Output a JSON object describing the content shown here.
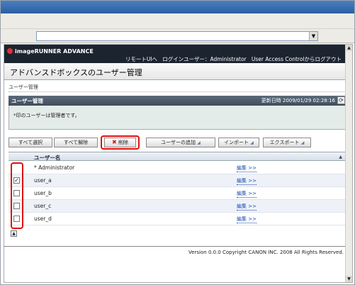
{
  "browser": {
    "address_value": "",
    "dropdown_glyph": "▼",
    "scroll_up_glyph": "▲",
    "scroll_down_glyph": "▼"
  },
  "header": {
    "brand": "imageRUNNER ADVANCE",
    "links": {
      "remote_ui": "リモートUIへ",
      "login_user_label": "ログインユーザー：",
      "login_user": "Administrator",
      "logout": "User Access Controlからログアウト"
    }
  },
  "page": {
    "title": "アドバンスドボックスのユーザー管理",
    "breadcrumb": "ユーザー管理"
  },
  "panel": {
    "title": "ユーザー管理",
    "updated": "更新日時 2009/01/29 02:28:16",
    "message": "*印のユーザーは管理者です。",
    "refresh_glyph": "⟳"
  },
  "toolbar": {
    "select_all": "すべて選択",
    "deselect_all": "すべて解除",
    "delete_glyph": "✖",
    "delete": "削除",
    "add_user": "ユーザーの追加",
    "import": "インポート",
    "export": "エクスポート",
    "arrow_glyph": "◢"
  },
  "table": {
    "column_header": "ユーザー名",
    "sort_glyph": "▲",
    "edit_label": "編集 >>",
    "rows": [
      {
        "name": "* Administrator",
        "checkbox": false,
        "checked_glyph": ""
      },
      {
        "name": "user_a",
        "checkbox": true,
        "checked_glyph": "✓"
      },
      {
        "name": "user_b",
        "checkbox": true,
        "checked_glyph": ""
      },
      {
        "name": "user_c",
        "checkbox": true,
        "checked_glyph": ""
      },
      {
        "name": "user_d",
        "checkbox": true,
        "checked_glyph": ""
      }
    ],
    "collapse_glyph": "▲"
  },
  "footer": {
    "version": "Version 0.0.0 Copyright CANON INC. 2008 All Rights Reserved."
  },
  "colors": {
    "header_bg": "#1c2430",
    "highlight": "#e01010",
    "link": "#1a4aa8"
  }
}
